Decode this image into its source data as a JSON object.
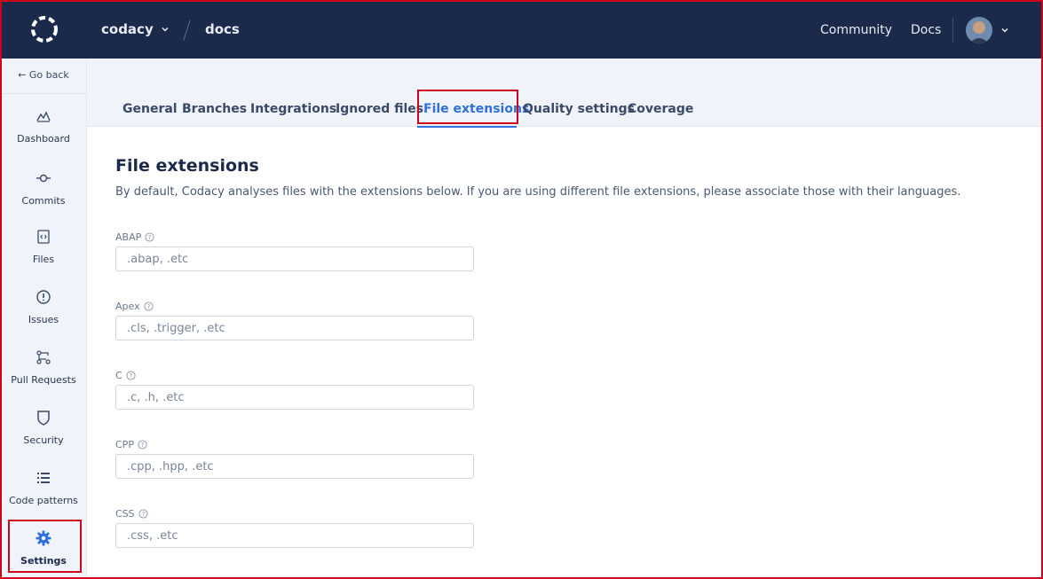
{
  "header": {
    "org": "codacy",
    "repo": "docs",
    "links": [
      "Community",
      "Docs"
    ]
  },
  "sidebar": {
    "go_back": "← Go back",
    "items": [
      {
        "label": "Dashboard",
        "icon": "chart-icon"
      },
      {
        "label": "Commits",
        "icon": "commit-icon"
      },
      {
        "label": "Files",
        "icon": "file-icon"
      },
      {
        "label": "Issues",
        "icon": "alert-icon"
      },
      {
        "label": "Pull Requests",
        "icon": "pull-request-icon"
      },
      {
        "label": "Security",
        "icon": "shield-icon"
      },
      {
        "label": "Code patterns",
        "icon": "list-icon"
      },
      {
        "label": "Settings",
        "icon": "gear-icon"
      }
    ]
  },
  "tabs": [
    "General",
    "Branches",
    "Integrations",
    "Ignored files",
    "File extensions",
    "Quality settings",
    "Coverage"
  ],
  "active_tab": "File extensions",
  "main": {
    "title": "File extensions",
    "description": "By default, Codacy analyses files with the extensions below. If you are using different file extensions, please associate those with their languages.",
    "fields": [
      {
        "label": "ABAP",
        "placeholder": ".abap, .etc",
        "value": ""
      },
      {
        "label": "Apex",
        "placeholder": ".cls, .trigger, .etc",
        "value": ""
      },
      {
        "label": "C",
        "placeholder": ".c, .h, .etc",
        "value": ""
      },
      {
        "label": "CPP",
        "placeholder": ".cpp, .hpp, .etc",
        "value": ""
      },
      {
        "label": "CSS",
        "placeholder": ".css, .etc",
        "value": ""
      }
    ]
  },
  "colors": {
    "header_bg": "#1b2a4a",
    "accent": "#2f6fe0",
    "highlight": "#d0021b"
  }
}
